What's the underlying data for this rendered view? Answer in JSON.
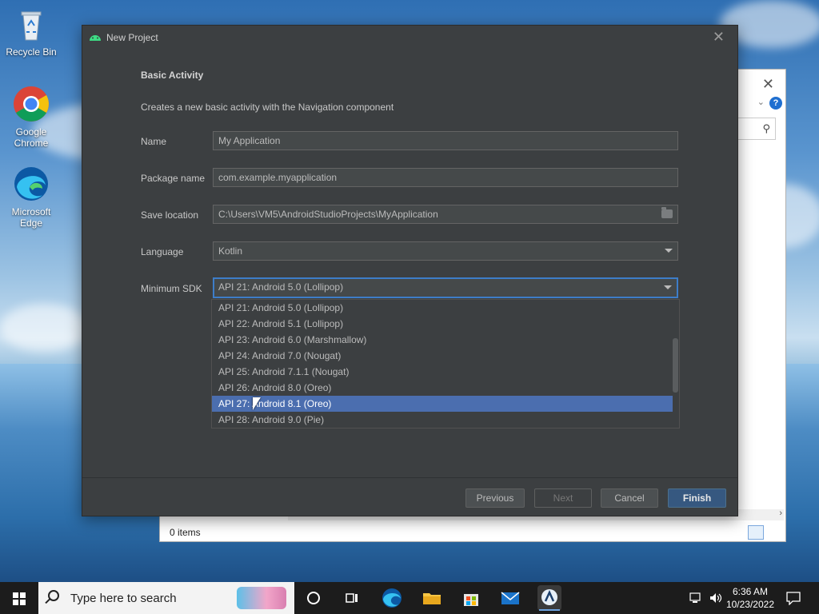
{
  "desktop": {
    "icons": [
      {
        "label": "Recycle Bin",
        "icon": "recycle-bin-icon"
      },
      {
        "label": "Google Chrome",
        "icon": "chrome-icon"
      },
      {
        "label": "Microsoft Edge",
        "icon": "edge-icon"
      }
    ]
  },
  "explorer": {
    "status": "0 items",
    "help_label": "?"
  },
  "dialog": {
    "title": "New Project",
    "heading": "Basic Activity",
    "description": "Creates a new basic activity with the Navigation component",
    "fields": {
      "name": {
        "label": "Name",
        "value": "My Application"
      },
      "package": {
        "label": "Package name",
        "value": "com.example.myapplication"
      },
      "location": {
        "label": "Save location",
        "value": "C:\\Users\\VM5\\AndroidStudioProjects\\MyApplication"
      },
      "language": {
        "label": "Language",
        "value": "Kotlin"
      },
      "min_sdk": {
        "label": "Minimum SDK",
        "value": "API 21: Android 5.0 (Lollipop)"
      }
    },
    "sdk_options": [
      "API 21: Android 5.0 (Lollipop)",
      "API 22: Android 5.1 (Lollipop)",
      "API 23: Android 6.0 (Marshmallow)",
      "API 24: Android 7.0 (Nougat)",
      "API 25: Android 7.1.1 (Nougat)",
      "API 26: Android 8.0 (Oreo)",
      "API 27: Android 8.1 (Oreo)",
      "API 28: Android 9.0 (Pie)"
    ],
    "highlighted_option": "API 27: Android 8.1 (Oreo)",
    "buttons": {
      "previous": "Previous",
      "next": "Next",
      "cancel": "Cancel",
      "finish": "Finish"
    }
  },
  "taskbar": {
    "search_placeholder": "Type here to search",
    "time": "6:36 AM",
    "date": "10/23/2022"
  },
  "colors": {
    "dialog_bg": "#3c3f41",
    "selection": "#4b6eaf",
    "focus": "#3d7dc8",
    "primary_button": "#365880"
  }
}
